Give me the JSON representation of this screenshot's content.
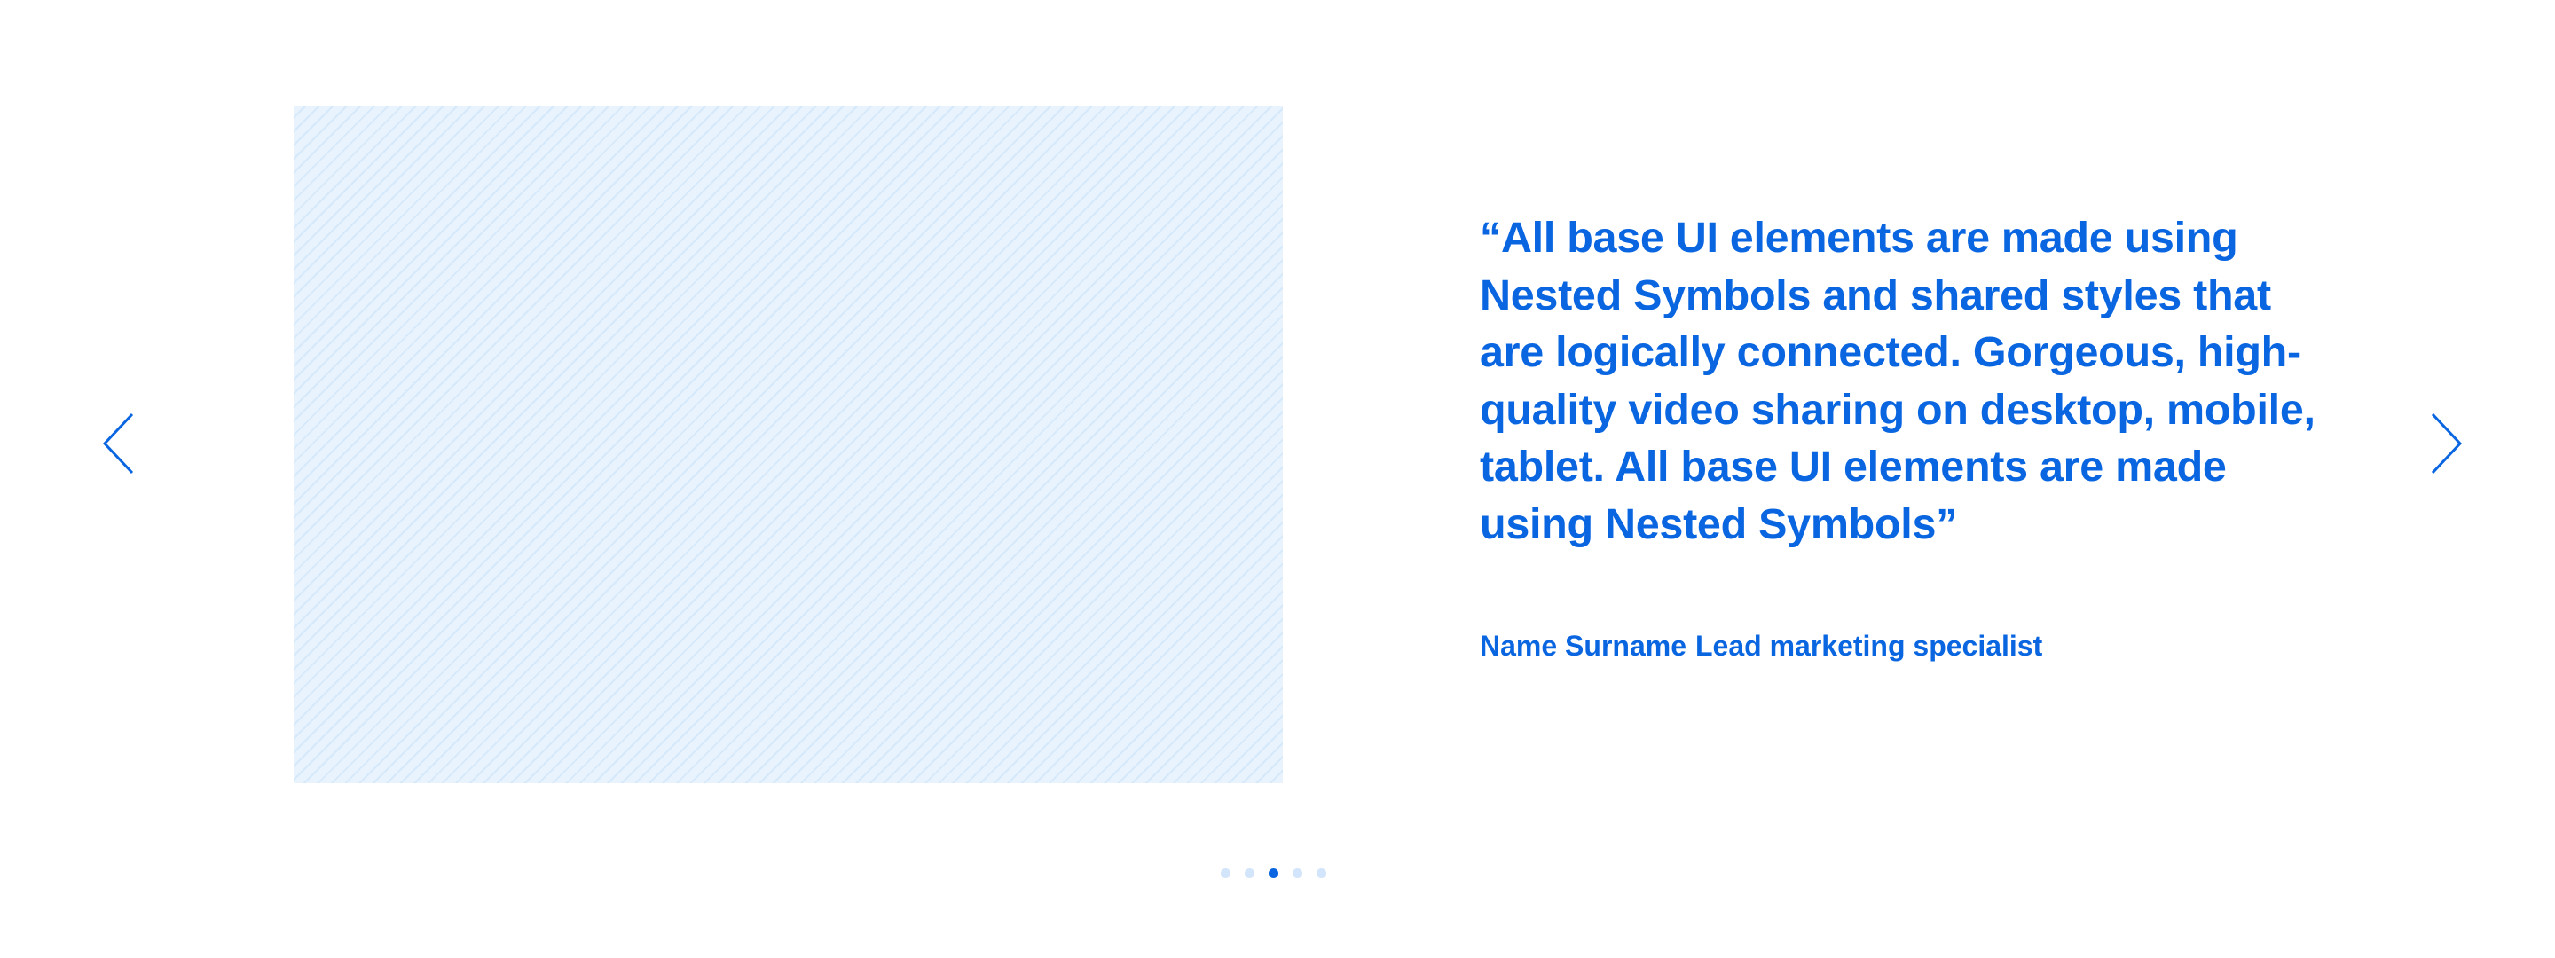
{
  "testimonial": {
    "quote": "“All base UI elements are made using Nested Symbols and shared styles that are logically connected. Gorgeous, high-quality video sharing on desktop, mobile, tablet. All base UI elements are made using Nested Symbols”",
    "author_name": "Name Surname",
    "author_role": "Lead marketing specialist"
  },
  "navigation": {
    "prev_icon": "chevron-left-icon",
    "next_icon": "chevron-right-icon"
  },
  "pagination": {
    "total": 5,
    "active_index": 2
  },
  "colors": {
    "accent": "#0a66e0",
    "dot_inactive": "#d3e5fb",
    "placeholder_bg": "#e8f3fd",
    "placeholder_stripe": "#d6e9fa"
  }
}
